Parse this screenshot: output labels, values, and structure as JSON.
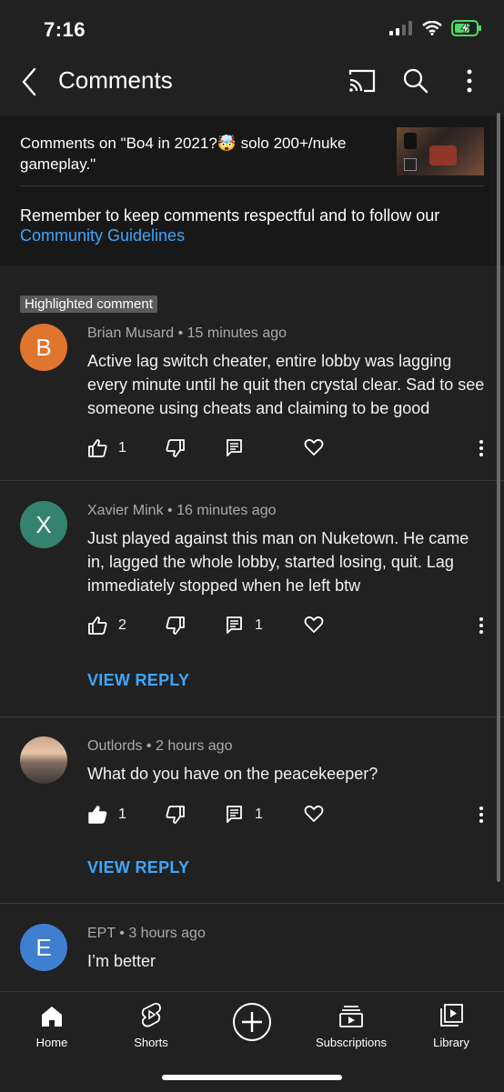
{
  "status": {
    "time": "7:16"
  },
  "header": {
    "title": "Comments"
  },
  "video": {
    "title_part1": "Comments on \"Bo4 in 2021?",
    "emoji": "🤯",
    "title_part2": " solo 200+/nuke gameplay.\""
  },
  "reminder": {
    "text": "Remember to keep comments respectful and to follow our",
    "link": "Community Guidelines"
  },
  "highlight_badge": "Highlighted comment",
  "comments": [
    {
      "initial": "B",
      "avatar_color": "#e0752d",
      "author": "Brian Musard",
      "time": "15 minutes ago",
      "text": "Active lag switch cheater, entire lobby was lagging every minute until he quit then crystal clear. Sad to see someone using cheats and claiming to be good",
      "likes": "1",
      "replies": ""
    },
    {
      "initial": "X",
      "avatar_color": "#35826e",
      "author": "Xavier Mink",
      "time": "16 minutes ago",
      "text": "Just played against this man on Nuketown. He came in, lagged the whole lobby, started losing, quit. Lag immediately stopped when he left btw",
      "likes": "2",
      "replies": "1",
      "view_reply": "VIEW REPLY"
    },
    {
      "initial": "",
      "avatar_color": "#8a6a5a",
      "author": "Outlords",
      "time": "2 hours ago",
      "text": "What do you have on the peacekeeper?",
      "likes": "1",
      "replies": "1",
      "view_reply": "VIEW REPLY"
    },
    {
      "initial": "E",
      "avatar_color": "#3f7fd0",
      "author": "EPT",
      "time": "3 hours ago",
      "text": "I’m better"
    }
  ],
  "nav": [
    {
      "label": "Home",
      "icon": "home-icon"
    },
    {
      "label": "Shorts",
      "icon": "shorts-icon"
    },
    {
      "label": "",
      "icon": "create-icon"
    },
    {
      "label": "Subscriptions",
      "icon": "subscriptions-icon"
    },
    {
      "label": "Library",
      "icon": "library-icon"
    }
  ]
}
